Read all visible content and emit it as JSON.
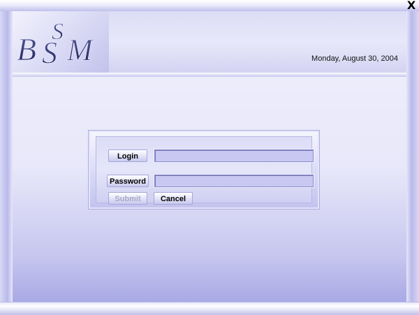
{
  "window": {
    "close_label": "X"
  },
  "header": {
    "logo_letters": "BSSM",
    "date": "Monday, August 30, 2004"
  },
  "login_form": {
    "login_label": "Login",
    "login_value": "",
    "password_label": "Password",
    "password_value": "",
    "submit_label": "Submit",
    "cancel_label": "Cancel"
  },
  "colors": {
    "accent": "#c8c8f2",
    "frame": "#c4c4ee",
    "disabled_text": "#a8a8c8"
  }
}
